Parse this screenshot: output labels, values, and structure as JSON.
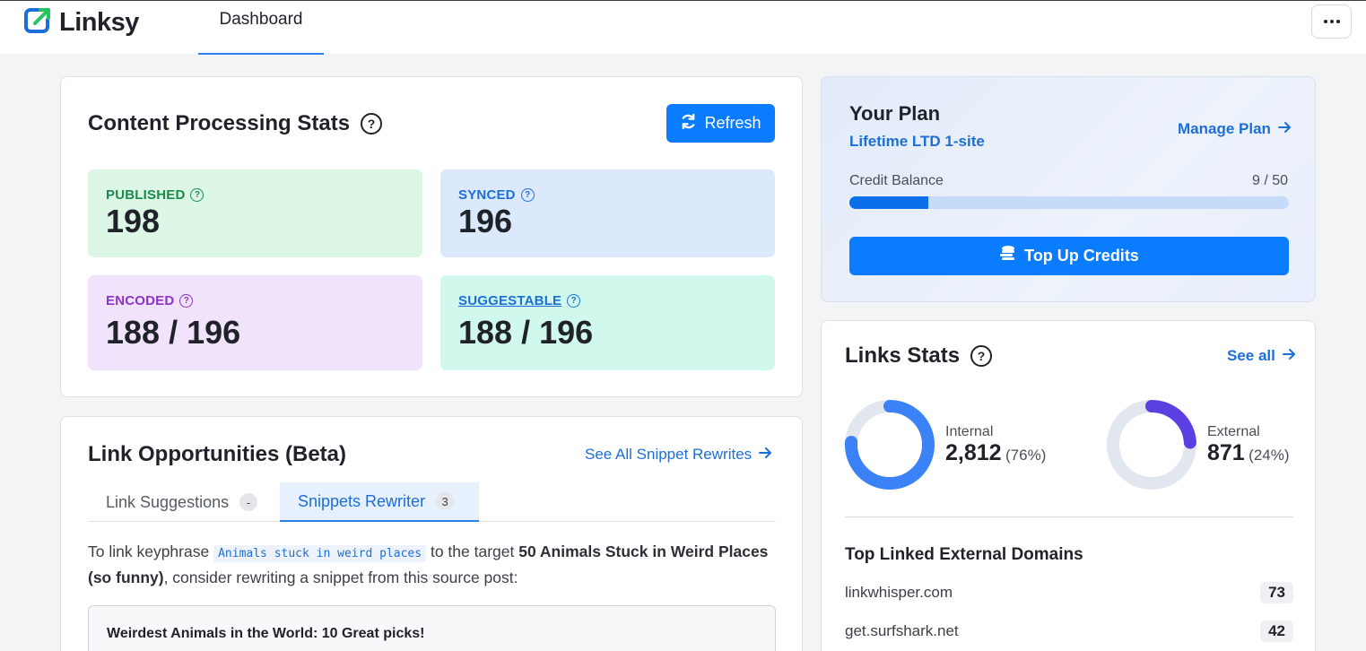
{
  "app": {
    "name": "Linksy",
    "nav_tab": "Dashboard"
  },
  "content_stats": {
    "title": "Content Processing Stats",
    "refresh_label": "Refresh",
    "tiles": [
      {
        "label": "PUBLISHED",
        "value": "198"
      },
      {
        "label": "SYNCED",
        "value": "196"
      },
      {
        "label": "ENCODED",
        "value": "188 / 196"
      },
      {
        "label": "SUGGESTABLE",
        "value": "188 / 196"
      }
    ]
  },
  "link_opportunities": {
    "title": "Link Opportunities (Beta)",
    "see_all_label": "See All Snippet Rewrites",
    "tabs": [
      {
        "label": "Link Suggestions",
        "count": "-"
      },
      {
        "label": "Snippets Rewriter",
        "count": "3"
      }
    ],
    "text_prefix": "To link keyphrase",
    "keyphrase": "Animals stuck in weird places",
    "text_mid": "to the target",
    "target": "50 Animals Stuck in Weird Places (so funny)",
    "text_suffix": ", consider rewriting a snippet from this source post:",
    "source_post": "Weirdest Animals in the World: 10 Great picks!"
  },
  "plan": {
    "title": "Your Plan",
    "name": "Lifetime LTD 1-site",
    "manage_label": "Manage Plan",
    "credit_label": "Credit Balance",
    "credit_value": "9 / 50",
    "credit_used": 9,
    "credit_total": 50,
    "topup_label": "Top Up Credits"
  },
  "links_stats": {
    "title": "Links Stats",
    "see_all_label": "See all",
    "internal": {
      "label": "Internal",
      "count": "2,812",
      "pct": "(76%)",
      "fraction": 0.76,
      "color": "#3b82f6"
    },
    "external": {
      "label": "External",
      "count": "871",
      "pct": "(24%)",
      "fraction": 0.24,
      "color": "#5b3fe0"
    },
    "domains_title": "Top Linked External Domains",
    "domains": [
      {
        "domain": "linkwhisper.com",
        "count": "73"
      },
      {
        "domain": "get.surfshark.net",
        "count": "42"
      }
    ]
  },
  "colors": {
    "accent": "#0a7cff",
    "link": "#1c6fd8",
    "donut_track": "#e2e7ef"
  }
}
